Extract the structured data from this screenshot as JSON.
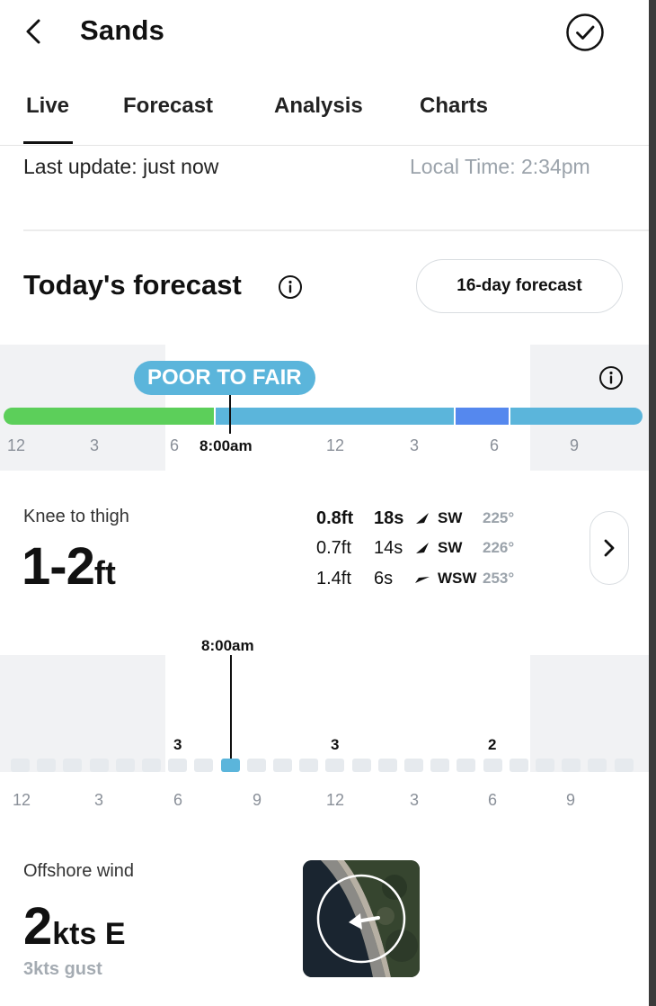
{
  "header": {
    "title": "Sands"
  },
  "tabs": [
    {
      "label": "Live"
    },
    {
      "label": "Forecast"
    },
    {
      "label": "Analysis"
    },
    {
      "label": "Charts"
    }
  ],
  "status": {
    "last_update": "Last update: just now",
    "local_time": "Local Time: 2:34pm"
  },
  "forecast": {
    "heading": "Today's forecast",
    "sixteen_day_button": "16-day forecast",
    "rating": "POOR TO FAIR",
    "current_time": "8:00am",
    "time_ticks": [
      "12",
      "3",
      "6",
      "12",
      "3",
      "6",
      "9"
    ],
    "rating_colors": {
      "fair": "#5ccf5a",
      "poor_to_fair": "#5bb5db",
      "poor": "#5588ee"
    }
  },
  "surf": {
    "label": "Knee to thigh",
    "height": "1-2",
    "unit": "ft",
    "swells": [
      {
        "height": "0.8ft",
        "period": "18s",
        "direction": "SW",
        "degrees": "225°"
      },
      {
        "height": "0.7ft",
        "period": "14s",
        "direction": "SW",
        "degrees": "226°"
      },
      {
        "height": "1.4ft",
        "period": "6s",
        "direction": "WSW",
        "degrees": "253°"
      }
    ]
  },
  "surf_chart": {
    "current_time": "8:00am",
    "values": [
      {
        "label": "3"
      },
      {
        "label": "3"
      },
      {
        "label": "2"
      }
    ],
    "time_ticks": [
      "12",
      "3",
      "6",
      "9",
      "12",
      "3",
      "6",
      "9"
    ]
  },
  "wind": {
    "label": "Offshore wind",
    "speed": "2",
    "unit": "kts",
    "direction": "E",
    "gust": "3kts gust"
  }
}
